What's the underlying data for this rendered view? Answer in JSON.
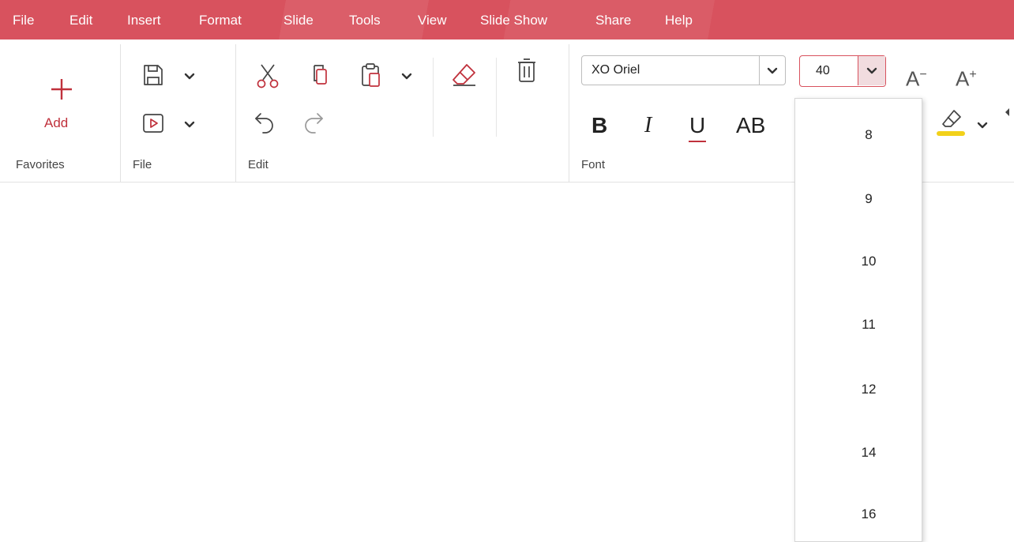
{
  "menu": {
    "items": [
      "File",
      "Edit",
      "Insert",
      "Format",
      "Slide",
      "Tools",
      "View",
      "Slide Show",
      "Share",
      "Help"
    ]
  },
  "ribbon": {
    "favorites": {
      "add_label": "Add",
      "group_label": "Favorites"
    },
    "file": {
      "group_label": "File"
    },
    "edit": {
      "group_label": "Edit"
    },
    "font": {
      "group_label": "Font",
      "font_name": "XO Oriel",
      "font_size": "40",
      "bold": "B",
      "italic": "I",
      "underline": "U",
      "caps": "AB",
      "shrink": "A",
      "grow": "A"
    }
  },
  "size_dropdown": {
    "options": [
      "8",
      "9",
      "10",
      "11",
      "12",
      "14",
      "16"
    ]
  },
  "colors": {
    "accent": "#d8525e",
    "highlight": "#f2d11a"
  }
}
